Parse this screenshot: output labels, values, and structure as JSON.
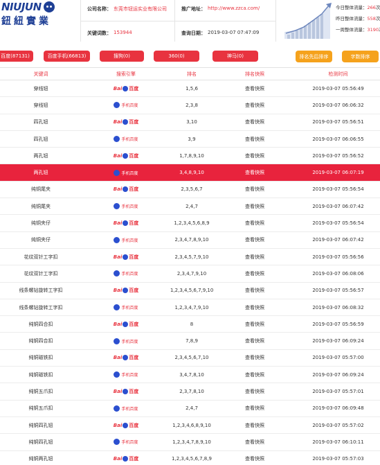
{
  "logo": {
    "en": "NIUJUN",
    "cn": "鈕紐實業"
  },
  "header": {
    "company_label": "公司名称：",
    "company_value": "东莞市钮运实业有限公司",
    "site_label": "推广地址：",
    "site_value": "http://www.zzca.com/",
    "keywords_label": "关键词数：",
    "keywords_value": "153944",
    "date_label": "查询日期：",
    "date_value": "2019-03-07 07:47:09"
  },
  "stats": [
    {
      "label": "今日整体流量：",
      "value": "266",
      "unit": "次"
    },
    {
      "label": "昨日整体流量：",
      "value": "558",
      "unit": "次"
    },
    {
      "label": "一周整体流量：",
      "value": "3190",
      "unit": "次"
    }
  ],
  "filters": {
    "baidu": "百度(87131)",
    "baidu_mobile": "百度手机(66813)",
    "sogou": "搜狗(0)",
    "s360": "360(0)",
    "shenma": "神马(0)",
    "sort_rank": "排名先后排序",
    "sort_chars": "字数排序"
  },
  "columns": [
    "关键词",
    "搜索引擎",
    "排名",
    "排名快照",
    "检测时间"
  ],
  "engine_labels": {
    "baidu_a": "Bai",
    "baidu_b": "百度",
    "mobile": "手机百度"
  },
  "rows": [
    {
      "keyword": "穿线钮",
      "engine": "baidu",
      "rank": "1,5,6",
      "snapshot": "查看快照",
      "time": "2019-03-07 05:56:49"
    },
    {
      "keyword": "穿线钮",
      "engine": "mobile",
      "rank": "2,3,8",
      "snapshot": "查看快照",
      "time": "2019-03-07 06:06:32"
    },
    {
      "keyword": "四孔钮",
      "engine": "baidu",
      "rank": "3,10",
      "snapshot": "查看快照",
      "time": "2019-03-07 05:56:51"
    },
    {
      "keyword": "四孔钮",
      "engine": "mobile",
      "rank": "3,9",
      "snapshot": "查看快照",
      "time": "2019-03-07 06:06:55"
    },
    {
      "keyword": "两孔钮",
      "engine": "baidu",
      "rank": "1,7,8,9,10",
      "snapshot": "查看快照",
      "time": "2019-03-07 05:56:52"
    },
    {
      "keyword": "两孔钮",
      "engine": "mobile",
      "rank": "3,4,8,9,10",
      "snapshot": "查看快照",
      "time": "2019-03-07 06:07:19"
    },
    {
      "keyword": "纯铜尾夹",
      "engine": "baidu",
      "rank": "2,3,5,6,7",
      "snapshot": "查看快照",
      "time": "2019-03-07 05:56:54"
    },
    {
      "keyword": "纯铜尾夹",
      "engine": "mobile",
      "rank": "2,4,7",
      "snapshot": "查看快照",
      "time": "2019-03-07 06:07:42"
    },
    {
      "keyword": "纯铜夹仔",
      "engine": "baidu",
      "rank": "1,2,3,4,5,6,8,9",
      "snapshot": "查看快照",
      "time": "2019-03-07 05:56:54"
    },
    {
      "keyword": "纯铜夹仔",
      "engine": "mobile",
      "rank": "2,3,4,7,8,9,10",
      "snapshot": "查看快照",
      "time": "2019-03-07 06:07:42"
    },
    {
      "keyword": "花纹双针工字扣",
      "engine": "baidu",
      "rank": "2,3,4,5,7,9,10",
      "snapshot": "查看快照",
      "time": "2019-03-07 05:56:56"
    },
    {
      "keyword": "花纹双针工字扣",
      "engine": "mobile",
      "rank": "2,3,4,7,9,10",
      "snapshot": "查看快照",
      "time": "2019-03-07 06:08:06"
    },
    {
      "keyword": "线条螺钻旋转工字扣",
      "engine": "baidu",
      "rank": "1,2,3,4,5,6,7,9,10",
      "snapshot": "查看快照",
      "time": "2019-03-07 05:56:57"
    },
    {
      "keyword": "线条螺钻旋转工字扣",
      "engine": "mobile",
      "rank": "1,2,3,4,7,9,10",
      "snapshot": "查看快照",
      "time": "2019-03-07 06:08:32"
    },
    {
      "keyword": "纯铜四合扣",
      "engine": "baidu",
      "rank": "8",
      "snapshot": "查看快照",
      "time": "2019-03-07 05:56:59"
    },
    {
      "keyword": "纯铜四合扣",
      "engine": "mobile",
      "rank": "7,8,9",
      "snapshot": "查看快照",
      "time": "2019-03-07 06:09:24"
    },
    {
      "keyword": "纯铜磁铁扣",
      "engine": "baidu",
      "rank": "2,3,4,5,6,7,10",
      "snapshot": "查看快照",
      "time": "2019-03-07 05:57:00"
    },
    {
      "keyword": "纯铜磁铁扣",
      "engine": "mobile",
      "rank": "3,4,7,8,10",
      "snapshot": "查看快照",
      "time": "2019-03-07 06:09:24"
    },
    {
      "keyword": "纯铜五爪扣",
      "engine": "baidu",
      "rank": "2,3,7,8,10",
      "snapshot": "查看快照",
      "time": "2019-03-07 05:57:01"
    },
    {
      "keyword": "纯铜五爪扣",
      "engine": "mobile",
      "rank": "2,4,7",
      "snapshot": "查看快照",
      "time": "2019-03-07 06:09:48"
    },
    {
      "keyword": "纯铜四孔钮",
      "engine": "baidu",
      "rank": "1,2,3,4,6,8,9,10",
      "snapshot": "查看快照",
      "time": "2019-03-07 05:57:02"
    },
    {
      "keyword": "纯铜四孔钮",
      "engine": "mobile",
      "rank": "1,2,3,4,7,8,9,10",
      "snapshot": "查看快照",
      "time": "2019-03-07 06:10:11"
    },
    {
      "keyword": "纯铜两孔钮",
      "engine": "baidu",
      "rank": "1,2,3,4,5,6,7,8,9",
      "snapshot": "查看快照",
      "time": "2019-03-07 05:57:03"
    }
  ],
  "highlighted_row": 5,
  "colors": {
    "accent": "#e8333f",
    "highlight": "#e8233d",
    "orange": "#f5a21c",
    "baidu_blue": "#2b4fcf",
    "logo_blue": "#1e3f95"
  }
}
